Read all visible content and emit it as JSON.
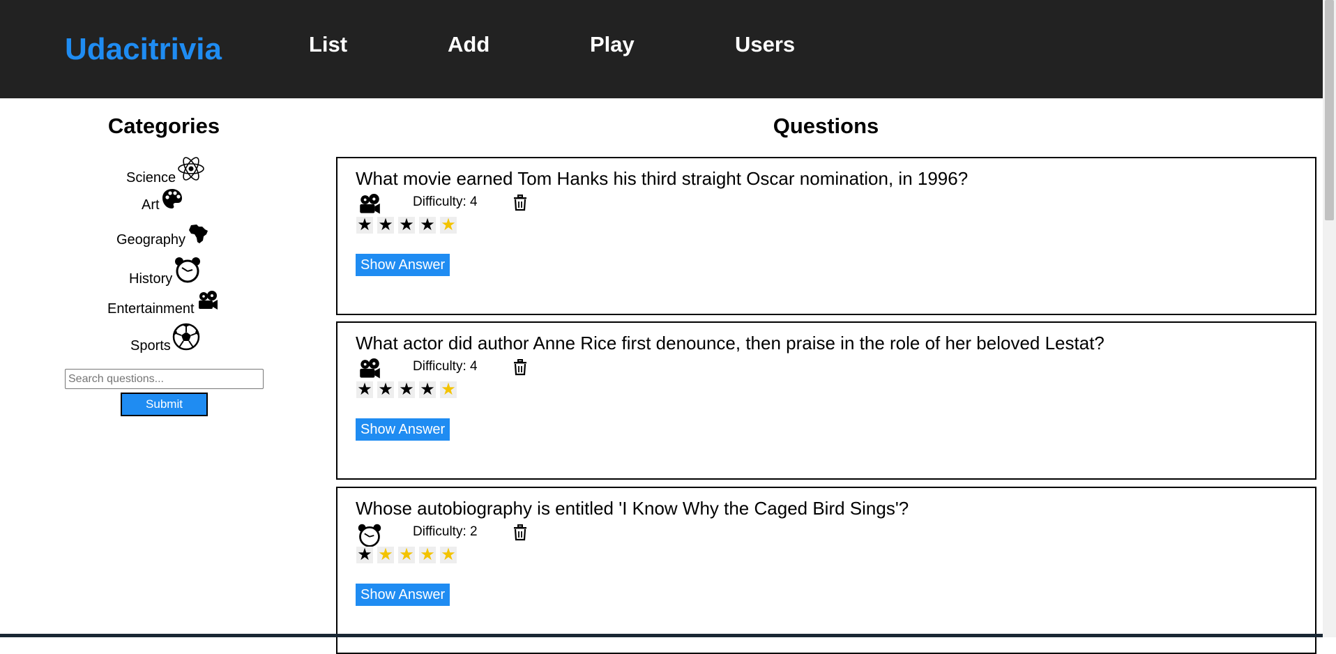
{
  "header": {
    "brand": "Udacitrivia",
    "nav": [
      "List",
      "Add",
      "Play",
      "Users"
    ]
  },
  "sidebar": {
    "title": "Categories",
    "categories": [
      {
        "label": "Science",
        "icon": "science-icon"
      },
      {
        "label": "Art",
        "icon": "art-icon"
      },
      {
        "label": "Geography",
        "icon": "geography-icon"
      },
      {
        "label": "History",
        "icon": "history-icon"
      },
      {
        "label": "Entertainment",
        "icon": "entertainment-icon"
      },
      {
        "label": "Sports",
        "icon": "sports-icon"
      }
    ],
    "search_placeholder": "Search questions...",
    "submit_label": "Submit"
  },
  "main": {
    "title": "Questions",
    "questions": [
      {
        "text": "What movie earned Tom Hanks his third straight Oscar nomination, in 1996?",
        "category_icon": "entertainment-icon",
        "difficulty_label": "Difficulty: 4",
        "difficulty": 4,
        "button": "Show Answer"
      },
      {
        "text": "What actor did author Anne Rice first denounce, then praise in the role of her beloved Lestat?",
        "category_icon": "entertainment-icon",
        "difficulty_label": "Difficulty: 4",
        "difficulty": 4,
        "button": "Show Answer"
      },
      {
        "text": "Whose autobiography is entitled 'I Know Why the Caged Bird Sings'?",
        "category_icon": "history-icon",
        "difficulty_label": "Difficulty: 2",
        "difficulty": 1,
        "button": "Show Answer"
      }
    ]
  },
  "colors": {
    "accent": "#1f8cf2",
    "navbar": "#222222",
    "star_empty": "#f3c300"
  }
}
